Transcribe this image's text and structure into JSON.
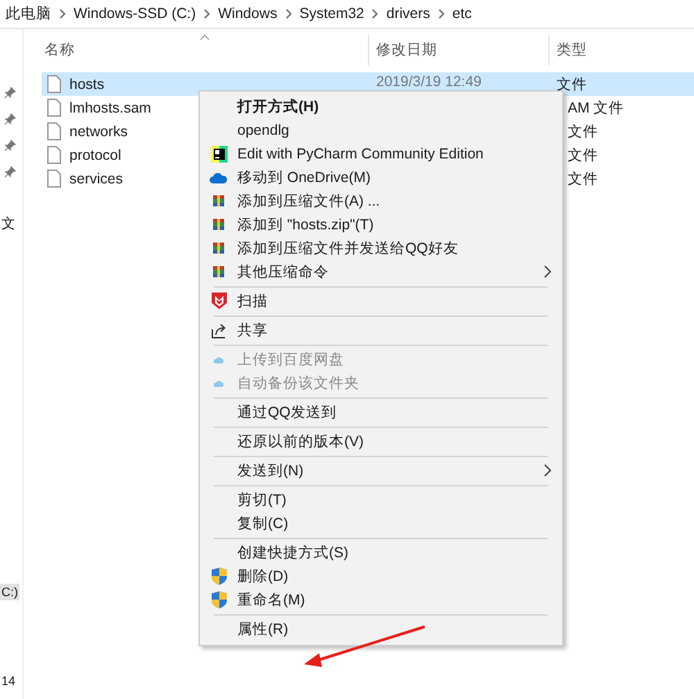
{
  "breadcrumb": [
    "此电脑",
    "Windows-SSD (C:)",
    "Windows",
    "System32",
    "drivers",
    "etc"
  ],
  "nav_pane": {
    "pins": [
      {
        "pinned": true
      },
      {
        "pinned": true
      },
      {
        "pinned": true
      },
      {
        "pinned": true
      }
    ],
    "items": [
      {
        "label": "文",
        "selected": false
      },
      {
        "label": "C:)",
        "selected": true
      },
      {
        "label": "14",
        "selected": false
      }
    ]
  },
  "file_list": {
    "columns": [
      {
        "label": "名称",
        "sorted": true
      },
      {
        "label": "修改日期",
        "sorted": false
      },
      {
        "label": "类型",
        "sorted": false
      }
    ],
    "rows": [
      {
        "name": "hosts",
        "modified": "2019/3/19 12:49",
        "type": "文件",
        "selected": true
      },
      {
        "name": "lmhosts.sam",
        "type": "AM 文件",
        "selected": false
      },
      {
        "name": "networks",
        "type": "文件",
        "selected": false
      },
      {
        "name": "protocol",
        "type": "文件",
        "selected": false
      },
      {
        "name": "services",
        "type": "文件",
        "selected": false
      }
    ]
  },
  "context_menu": {
    "items": [
      {
        "kind": "plain",
        "label": "打开方式(H)",
        "default": true,
        "disabled": false,
        "submenu": false
      },
      {
        "kind": "plain",
        "label": "opendlg",
        "default": false,
        "disabled": false,
        "submenu": false
      },
      {
        "kind": "pycharm",
        "label": "Edit with PyCharm Community Edition",
        "default": false,
        "disabled": false,
        "submenu": false
      },
      {
        "kind": "onedrive",
        "label": "移动到 OneDrive(M)",
        "default": false,
        "disabled": false,
        "submenu": false
      },
      {
        "kind": "archive",
        "label": "添加到压缩文件(A) ...",
        "default": false,
        "disabled": false,
        "submenu": false
      },
      {
        "kind": "archive",
        "label": "添加到 \"hosts.zip\"(T)",
        "default": false,
        "disabled": false,
        "submenu": false
      },
      {
        "kind": "archive",
        "label": "添加到压缩文件并发送给QQ好友",
        "default": false,
        "disabled": false,
        "submenu": false
      },
      {
        "kind": "archive",
        "label": "其他压缩命令",
        "default": false,
        "disabled": false,
        "submenu": true
      },
      {
        "kind": "separator"
      },
      {
        "kind": "antivirus",
        "label": "扫描",
        "default": false,
        "disabled": false,
        "submenu": false
      },
      {
        "kind": "separator"
      },
      {
        "kind": "share",
        "label": "共享",
        "default": false,
        "disabled": false,
        "submenu": false
      },
      {
        "kind": "separator"
      },
      {
        "kind": "cloud",
        "label": "上传到百度网盘",
        "default": false,
        "disabled": true,
        "submenu": false
      },
      {
        "kind": "cloud",
        "label": "自动备份该文件夹",
        "default": false,
        "disabled": true,
        "submenu": false
      },
      {
        "kind": "separator"
      },
      {
        "kind": "plain",
        "label": "通过QQ发送到",
        "default": false,
        "disabled": false,
        "submenu": false
      },
      {
        "kind": "separator"
      },
      {
        "kind": "plain",
        "label": "还原以前的版本(V)",
        "default": false,
        "disabled": false,
        "submenu": false
      },
      {
        "kind": "separator"
      },
      {
        "kind": "plain",
        "label": "发送到(N)",
        "default": false,
        "disabled": false,
        "submenu": true
      },
      {
        "kind": "separator"
      },
      {
        "kind": "plain",
        "label": "剪切(T)",
        "default": false,
        "disabled": false,
        "submenu": false
      },
      {
        "kind": "plain",
        "label": "复制(C)",
        "default": false,
        "disabled": false,
        "submenu": false
      },
      {
        "kind": "separator"
      },
      {
        "kind": "plain",
        "label": "创建快捷方式(S)",
        "default": false,
        "disabled": false,
        "submenu": false
      },
      {
        "kind": "shield",
        "label": "删除(D)",
        "default": false,
        "disabled": false,
        "submenu": false
      },
      {
        "kind": "shield",
        "label": "重命名(M)",
        "default": false,
        "disabled": false,
        "submenu": false
      },
      {
        "kind": "separator"
      },
      {
        "kind": "plain",
        "label": "属性(R)",
        "default": false,
        "disabled": false,
        "submenu": false
      }
    ]
  }
}
